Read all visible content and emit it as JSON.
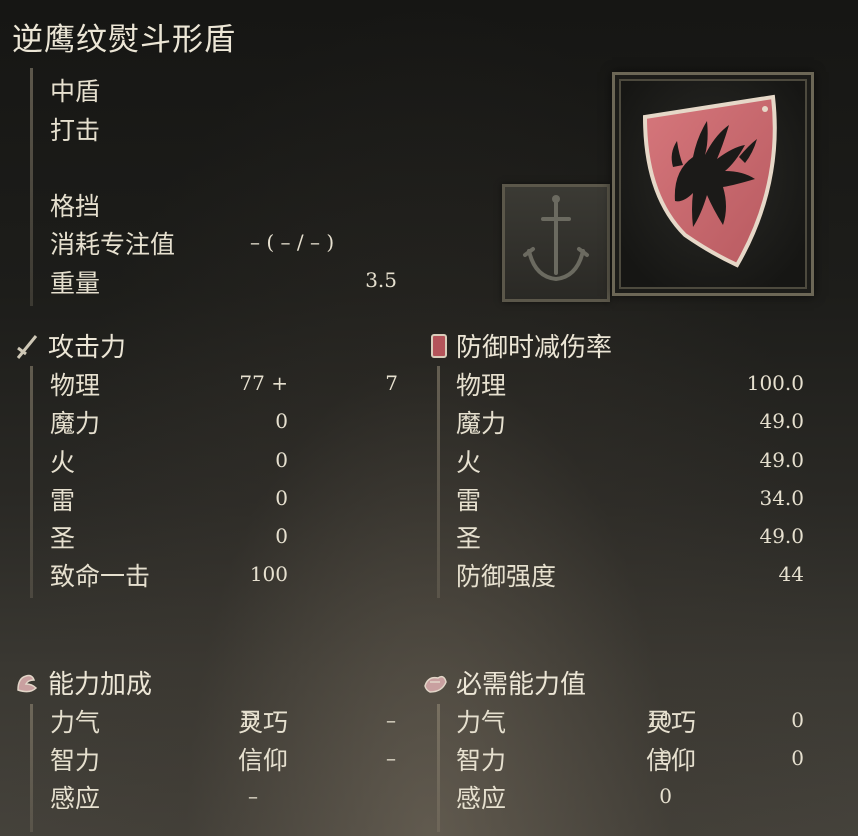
{
  "item": {
    "name": "逆鹰纹熨斗形盾",
    "category": "中盾",
    "attack_type": "打击",
    "skill": "格挡",
    "fp_cost_label": "消耗专注值",
    "fp_cost_value": "– (  – /  – )",
    "weight_label": "重量",
    "weight_value": "3.5"
  },
  "attack": {
    "header": "攻击力",
    "rows": [
      {
        "label": "物理",
        "value": "77 +",
        "extra": "7"
      },
      {
        "label": "魔力",
        "value": "0",
        "extra": ""
      },
      {
        "label": "火",
        "value": "0",
        "extra": ""
      },
      {
        "label": "雷",
        "value": "0",
        "extra": ""
      },
      {
        "label": "圣",
        "value": "0",
        "extra": ""
      },
      {
        "label": "致命一击",
        "value": "100",
        "extra": ""
      }
    ]
  },
  "guard": {
    "header": "防御时减伤率",
    "rows": [
      {
        "label": "物理",
        "value": "100.0"
      },
      {
        "label": "魔力",
        "value": "49.0"
      },
      {
        "label": "火",
        "value": "49.0"
      },
      {
        "label": "雷",
        "value": "34.0"
      },
      {
        "label": "圣",
        "value": "49.0"
      },
      {
        "label": "防御强度",
        "value": "44"
      }
    ]
  },
  "scaling": {
    "header": "能力加成",
    "rows": [
      {
        "l1": "力气",
        "v1": "D",
        "l2": "灵巧",
        "v2": "–"
      },
      {
        "l1": "智力",
        "v1": "–",
        "l2": "信仰",
        "v2": "–"
      },
      {
        "l1": "感应",
        "v1": "–",
        "l2": "",
        "v2": ""
      }
    ]
  },
  "requirements": {
    "header": "必需能力值",
    "rows": [
      {
        "l1": "力气",
        "v1": "10",
        "l2": "灵巧",
        "v2": "0"
      },
      {
        "l1": "智力",
        "v1": "0",
        "l2": "信仰",
        "v2": "0"
      },
      {
        "l1": "感应",
        "v1": "0",
        "l2": "",
        "v2": ""
      }
    ]
  },
  "icons": {
    "attack": "sword-icon",
    "guard": "shield-badge-icon",
    "scaling": "flexed-arm-icon",
    "requirements": "hand-icon",
    "ash_of_war": "sword-anchor-icon",
    "shield": "eagle-crest-shield-icon"
  },
  "colors": {
    "shield_red": "#c9666c",
    "text": "#e6e0cf",
    "frame": "#6c6756"
  }
}
